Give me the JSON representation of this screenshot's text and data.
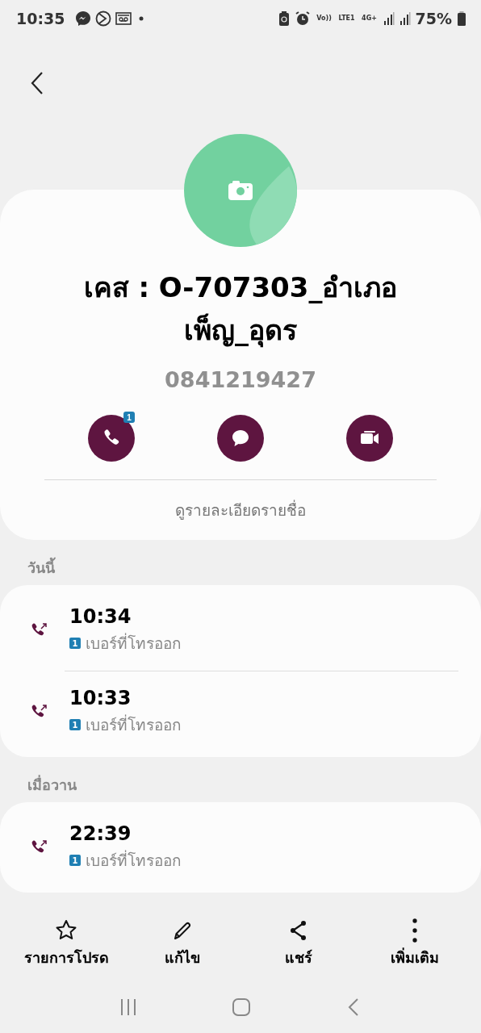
{
  "status_bar": {
    "time": "10:35",
    "network_labels": [
      "Vo))",
      "LTE1",
      "4G+"
    ],
    "battery": "75%"
  },
  "contact": {
    "name": "เคส : O-707303_อำเภอเพ็ญ_อุดร",
    "phone": "0841219427",
    "actions": [
      {
        "kind": "call",
        "badge": "1"
      },
      {
        "kind": "message"
      },
      {
        "kind": "video"
      }
    ],
    "details_link": "ดูรายละเอียดรายชื่อ"
  },
  "call_groups": [
    {
      "heading": "วันนี้",
      "calls": [
        {
          "time": "10:34",
          "sim": "1",
          "label": "เบอร์ที่โทรออก"
        },
        {
          "time": "10:33",
          "sim": "1",
          "label": "เบอร์ที่โทรออก"
        }
      ]
    },
    {
      "heading": "เมื่อวาน",
      "calls": [
        {
          "time": "22:39",
          "sim": "1",
          "label": "เบอร์ที่โทรออก"
        }
      ]
    }
  ],
  "bottom_bar": [
    {
      "kind": "star",
      "label": "รายการโปรด"
    },
    {
      "kind": "edit",
      "label": "แก้ไข"
    },
    {
      "kind": "share",
      "label": "แชร์"
    },
    {
      "kind": "more",
      "label": "เพิ่มเติม"
    }
  ]
}
